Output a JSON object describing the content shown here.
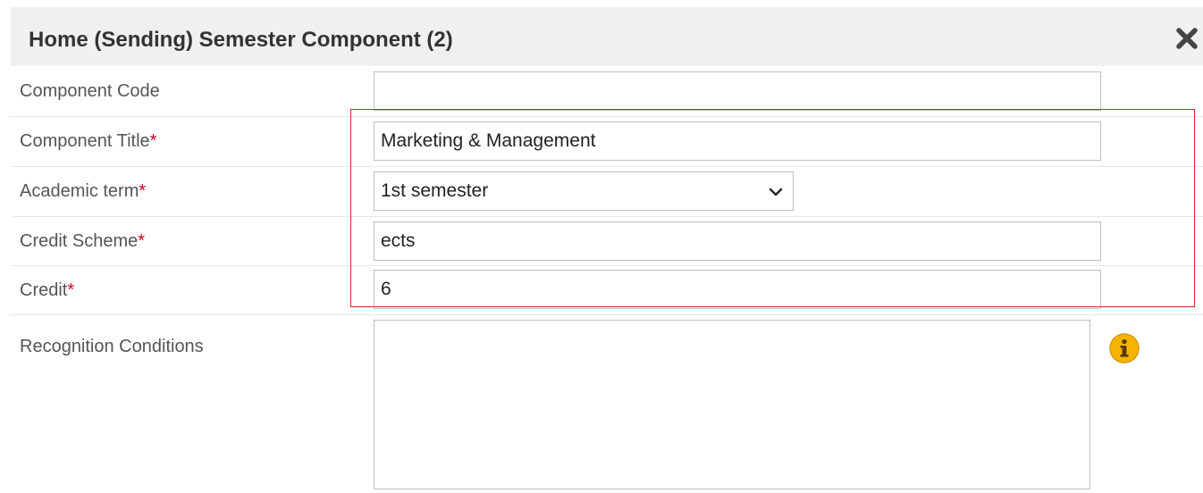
{
  "dialog": {
    "title": "Home (Sending) Semester Component (2)",
    "close_icon": "close-icon"
  },
  "form": {
    "component_code": {
      "label": "Component Code",
      "required": false,
      "value": ""
    },
    "component_title": {
      "label": "Component Title",
      "required_marker": "*",
      "value": "Marketing & Management"
    },
    "academic_term": {
      "label": "Academic term",
      "required_marker": "*",
      "value": "1st semester",
      "icon": "chevron-down-icon"
    },
    "credit_scheme": {
      "label": "Credit Scheme",
      "required_marker": "*",
      "value": "ects"
    },
    "credit": {
      "label": "Credit",
      "required_marker": "*",
      "value": "6"
    },
    "recognition_conditions": {
      "label": "Recognition Conditions",
      "value": "",
      "icon": "info-icon"
    }
  },
  "colors": {
    "header_bg": "#f0f0f0",
    "required": "#d0021b",
    "highlight": "#d9232e",
    "info": "#f5b400"
  }
}
